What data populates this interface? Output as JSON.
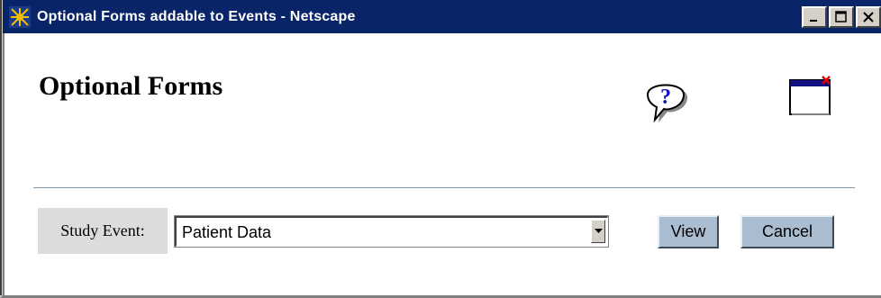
{
  "window": {
    "title": "Optional Forms addable to Events - Netscape",
    "app_icon": "netscape-icon",
    "controls": [
      "minimize-icon",
      "maximize-icon",
      "close-icon"
    ]
  },
  "page": {
    "heading": "Optional Forms",
    "help_icon": "help-icon",
    "close_window_icon": "close-window-icon"
  },
  "form": {
    "study_event_label": "Study Event:",
    "study_event_value": "Patient Data"
  },
  "buttons": {
    "view_label": "View",
    "cancel_label": "Cancel"
  },
  "colors": {
    "titlebar": "#0a246a",
    "button_face": "#a9bcd0",
    "label_bg": "#dcdcdc",
    "divider": "#8096a8"
  }
}
